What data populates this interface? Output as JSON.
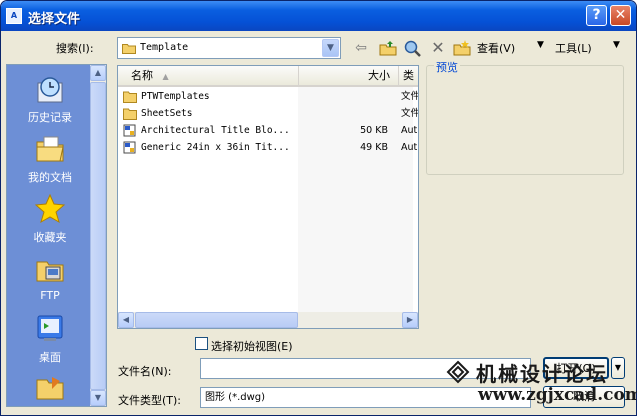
{
  "window": {
    "app_icon": "A",
    "title": "选择文件",
    "help_label": "?",
    "close_label": "✕"
  },
  "toolbar": {
    "look_in_label": "搜索(I):",
    "look_in_value": "Template",
    "view_label": "查看(V)",
    "tools_label": "工具(L)",
    "icons": [
      "back-arrow-icon",
      "up-folder-icon",
      "search-web-icon",
      "delete-icon",
      "create-folder-icon",
      "views-icon",
      "tools-icon"
    ]
  },
  "places": {
    "items": [
      {
        "label": "历史记录",
        "icon": "history-icon"
      },
      {
        "label": "我的文档",
        "icon": "my-documents-icon"
      },
      {
        "label": "收藏夹",
        "icon": "favorites-icon"
      },
      {
        "label": "FTP",
        "icon": "ftp-icon"
      },
      {
        "label": "桌面",
        "icon": "desktop-icon"
      },
      {
        "label": "",
        "icon": "buzzsaw-icon"
      }
    ]
  },
  "file_list": {
    "columns": {
      "name": "名称",
      "size": "大小",
      "type": "类"
    },
    "rows": [
      {
        "name": "PTWTemplates",
        "size": "",
        "type": "文件",
        "kind": "folder"
      },
      {
        "name": "SheetSets",
        "size": "",
        "type": "文件",
        "kind": "folder"
      },
      {
        "name": "Architectural Title Blo...",
        "size": "50 KB",
        "type": "Aut",
        "kind": "dwt"
      },
      {
        "name": "Generic 24in x 36in Tit...",
        "size": "49 KB",
        "type": "Aut",
        "kind": "dwt"
      }
    ]
  },
  "preview": {
    "label": "预览"
  },
  "initial_view": {
    "label": "选择初始视图(E)",
    "checked": false
  },
  "file_name": {
    "label": "文件名(N):",
    "value": ""
  },
  "file_type": {
    "label": "文件类型(T):",
    "value": "图形 (*.dwg)"
  },
  "buttons": {
    "open": "打开(O)",
    "cancel": "取消"
  },
  "watermark": {
    "text": "机械设计论坛",
    "url": "www.zgjxcad.com"
  }
}
